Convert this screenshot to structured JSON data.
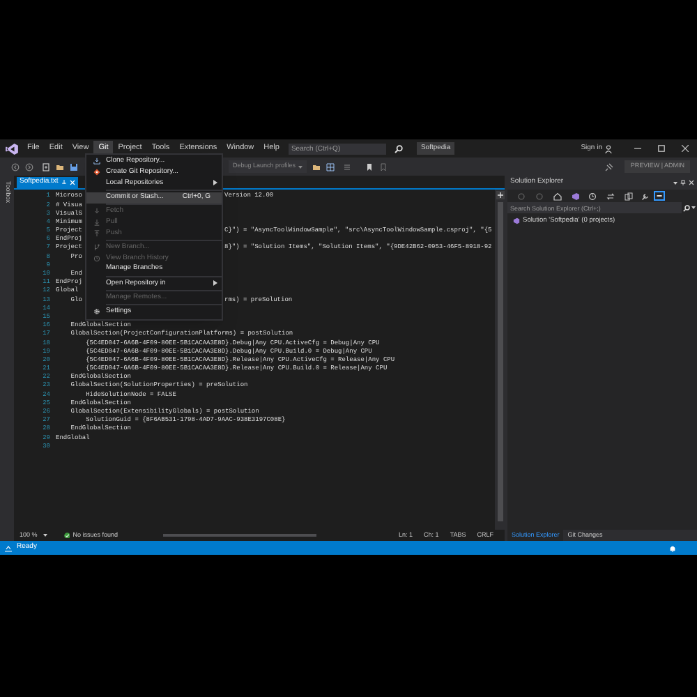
{
  "title_bar": {
    "menu": [
      {
        "label": "File",
        "selected": false
      },
      {
        "label": "Edit",
        "selected": false
      },
      {
        "label": "View",
        "selected": false
      },
      {
        "label": "Git",
        "selected": true
      },
      {
        "label": "Project",
        "selected": false
      },
      {
        "label": "Tools",
        "selected": false
      },
      {
        "label": "Extensions",
        "selected": false
      },
      {
        "label": "Window",
        "selected": false
      },
      {
        "label": "Help",
        "selected": false
      }
    ],
    "search": {
      "placeholder": "Search (Ctrl+Q)"
    },
    "solution_name": "Softpedia",
    "sign_in": "Sign in"
  },
  "toolbar": {
    "launch_profiles": "Debug Launch profiles",
    "badge": "PREVIEW | ADMIN"
  },
  "toolbox_tab": "Toolbox",
  "editor": {
    "tab": {
      "label": "Softpedia.txt",
      "selected": true
    },
    "lines": [
      {
        "number": "1",
        "text": "Microso",
        "continued": "Version 12.00"
      },
      {
        "number": "2",
        "text": "# Visua"
      },
      {
        "number": "3",
        "text": "VisualS"
      },
      {
        "number": "4",
        "text": "Minimum"
      },
      {
        "number": "5",
        "text": "Project",
        "continued": "C}\") = \"AsyncToolWindowSample\", \"src\\AsyncToolWindowSample.csproj\", \"{5"
      },
      {
        "number": "6",
        "text": "EndProj"
      },
      {
        "number": "7",
        "text": "Project",
        "continued": "8}\") = \"Solution Items\", \"Solution Items\", \"{9DE42B62-0953-46F5-8918-92"
      },
      {
        "number": "8",
        "text": "    Pro"
      },
      {
        "number": "9"
      },
      {
        "number": "10",
        "text": "    End"
      },
      {
        "number": "11",
        "text": "EndProj"
      },
      {
        "number": "12",
        "text": "Global"
      },
      {
        "number": "13",
        "text": "    Glo",
        "continued": "rms) = preSolution"
      },
      {
        "number": "14"
      },
      {
        "number": "15"
      },
      {
        "number": "16",
        "text": "    EndGlobalSection"
      },
      {
        "number": "17",
        "text": "    GlobalSection(ProjectConfigurationPlatforms) = postSolution"
      },
      {
        "number": "18",
        "text": "        {5C4ED047-6A6B-4F09-80EE-5B1CACAA3E8D}.Debug|Any CPU.ActiveCfg = Debug|Any CPU"
      },
      {
        "number": "19",
        "text": "        {5C4ED047-6A6B-4F09-80EE-5B1CACAA3E8D}.Debug|Any CPU.Build.0 = Debug|Any CPU"
      },
      {
        "number": "20",
        "text": "        {5C4ED047-6A6B-4F09-80EE-5B1CACAA3E8D}.Release|Any CPU.ActiveCfg = Release|Any CPU"
      },
      {
        "number": "21",
        "text": "        {5C4ED047-6A6B-4F09-80EE-5B1CACAA3E8D}.Release|Any CPU.Build.0 = Release|Any CPU"
      },
      {
        "number": "22",
        "text": "    EndGlobalSection"
      },
      {
        "number": "23",
        "text": "    GlobalSection(SolutionProperties) = preSolution"
      },
      {
        "number": "24",
        "text": "        HideSolutionNode = FALSE"
      },
      {
        "number": "25",
        "text": "    EndGlobalSection"
      },
      {
        "number": "26",
        "text": "    GlobalSection(ExtensibilityGlobals) = postSolution"
      },
      {
        "number": "27",
        "text": "        SolutionGuid = {8F6AB531-1798-4AD7-9AAC-938E3197C08E}"
      },
      {
        "number": "28",
        "text": "    EndGlobalSection"
      },
      {
        "number": "29",
        "text": "EndGlobal"
      },
      {
        "number": "30"
      }
    ],
    "zoom": "100 %",
    "issues": "No issues found",
    "position": [
      "Ln: 1",
      "Ch: 1",
      "TABS",
      "CRLF"
    ]
  },
  "git_menu": [
    {
      "kind": "item",
      "label": "Clone Repository...",
      "disabled": false,
      "selected": false,
      "submenu": false
    },
    {
      "kind": "item",
      "label": "Create Git Repository...",
      "disabled": false,
      "selected": false,
      "submenu": false
    },
    {
      "kind": "item",
      "label": "Local Repositories",
      "disabled": false,
      "selected": false,
      "submenu": true
    },
    {
      "kind": "separator"
    },
    {
      "kind": "item",
      "label": "Commit or Stash...",
      "shortcut": "Ctrl+0, G",
      "disabled": false,
      "selected": true,
      "submenu": false
    },
    {
      "kind": "separator"
    },
    {
      "kind": "item",
      "label": "Fetch",
      "disabled": true,
      "selected": false,
      "submenu": false
    },
    {
      "kind": "item",
      "label": "Pull",
      "disabled": true,
      "selected": false,
      "submenu": false
    },
    {
      "kind": "item",
      "label": "Push",
      "disabled": true,
      "selected": false,
      "submenu": false
    },
    {
      "kind": "separator"
    },
    {
      "kind": "item",
      "label": "New Branch...",
      "disabled": true,
      "selected": false,
      "submenu": false
    },
    {
      "kind": "item",
      "label": "View Branch History",
      "disabled": true,
      "selected": false,
      "submenu": false
    },
    {
      "kind": "item",
      "label": "Manage Branches",
      "disabled": false,
      "selected": false,
      "submenu": false
    },
    {
      "kind": "separator"
    },
    {
      "kind": "item",
      "label": "Open Repository in",
      "disabled": false,
      "selected": false,
      "submenu": true
    },
    {
      "kind": "separator"
    },
    {
      "kind": "item",
      "label": "Manage Remotes...",
      "disabled": true,
      "selected": false,
      "submenu": false
    },
    {
      "kind": "separator"
    },
    {
      "kind": "item",
      "label": "Settings",
      "disabled": false,
      "selected": false,
      "submenu": false
    }
  ],
  "solution_explorer": {
    "title": "Solution Explorer",
    "search": {
      "placeholder": "Search Solution Explorer (Ctrl+;)"
    },
    "tree": [
      {
        "label": "Solution 'Softpedia' (0 projects)"
      }
    ]
  },
  "bottom_tabs": [
    {
      "label": "Solution Explorer",
      "selected": true
    },
    {
      "label": "Git Changes",
      "selected": false
    }
  ],
  "status_bar": {
    "text": "Ready"
  }
}
